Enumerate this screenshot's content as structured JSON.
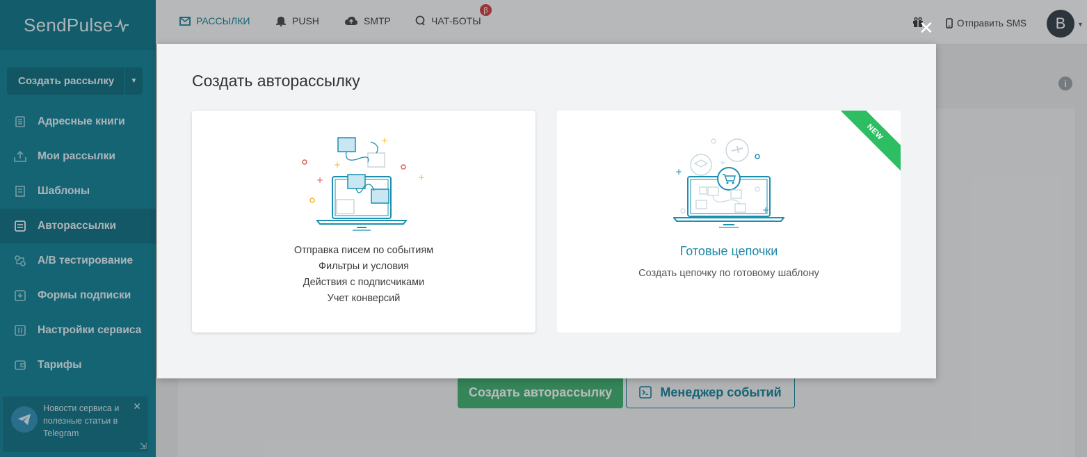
{
  "app": {
    "logo": "SendPulse"
  },
  "sidebar": {
    "create_button": "Создать рассылку",
    "items": [
      {
        "label": "Адресные книги",
        "icon": "address-book-icon"
      },
      {
        "label": "Мои рассылки",
        "icon": "campaigns-icon"
      },
      {
        "label": "Шаблоны",
        "icon": "templates-icon"
      },
      {
        "label": "Авторассылки",
        "icon": "automation-icon",
        "active": true
      },
      {
        "label": "A/B тестирование",
        "icon": "ab-test-icon"
      },
      {
        "label": "Формы подписки",
        "icon": "forms-icon"
      },
      {
        "label": "Настройки сервиса",
        "icon": "settings-icon"
      },
      {
        "label": "Тарифы",
        "icon": "wallet-icon"
      }
    ],
    "promo": {
      "text": "Новости сервиса и полезные статьи в Telegram"
    }
  },
  "topbar": {
    "tabs": [
      {
        "label": "РАССЫЛКИ",
        "icon": "mail-icon",
        "active": true
      },
      {
        "label": "PUSH",
        "icon": "bell-icon"
      },
      {
        "label": "SMTP",
        "icon": "cloud-upload-icon"
      },
      {
        "label": "ЧАТ-БОТЫ",
        "icon": "chat-icon"
      }
    ],
    "beta_badge": "β",
    "sms_label": "Отправить SMS",
    "avatar_letter": "B"
  },
  "background": {
    "create_button": "Создать авторассылку",
    "events_button": "Менеджер событий"
  },
  "modal": {
    "title": "Создать авторассылку",
    "card1": {
      "features": [
        "Отправка писем по событиям",
        "Фильтры и условия",
        "Действия с подписчиками",
        "Учет конверсий"
      ]
    },
    "card2": {
      "title": "Готовые цепочки",
      "subtitle": "Создать цепочку по готовому шаблону",
      "ribbon": "NEW"
    }
  },
  "colors": {
    "sidebar": "#0c7f94",
    "accent": "#0c7f94",
    "green": "#3ab06a",
    "ribbon": "#2dbd62"
  }
}
